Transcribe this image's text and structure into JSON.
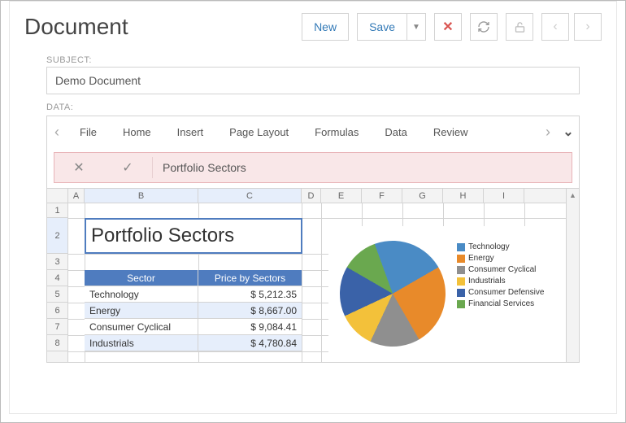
{
  "header": {
    "title": "Document",
    "new_label": "New",
    "save_label": "Save"
  },
  "form": {
    "subject_label": "SUBJECT:",
    "subject_value": "Demo Document",
    "data_label": "DATA:"
  },
  "ribbon": {
    "tabs": [
      "File",
      "Home",
      "Insert",
      "Page Layout",
      "Formulas",
      "Data",
      "Review"
    ]
  },
  "formula_bar": {
    "value": "Portfolio Sectors"
  },
  "grid": {
    "col_letters": [
      "A",
      "B",
      "C",
      "D",
      "E",
      "F",
      "G",
      "H",
      "I"
    ],
    "row_numbers": [
      "1",
      "2",
      "3",
      "4",
      "5",
      "6",
      "7",
      "8"
    ],
    "title_cell": "Portfolio Sectors",
    "headers": {
      "sector": "Sector",
      "price": "Price by Sectors"
    },
    "rows": [
      {
        "sector": "Technology",
        "price": "$ 5,212.35"
      },
      {
        "sector": "Energy",
        "price": "$ 8,667.00"
      },
      {
        "sector": "Consumer Cyclical",
        "price": "$ 9,084.41"
      },
      {
        "sector": "Industrials",
        "price": "$ 4,780.84"
      }
    ]
  },
  "chart_data": {
    "type": "pie",
    "title": "",
    "series": [
      {
        "name": "Technology",
        "value": 5212.35,
        "color": "#4a8bc5"
      },
      {
        "name": "Energy",
        "value": 8667.0,
        "color": "#e88a2a"
      },
      {
        "name": "Consumer Cyclical",
        "value": 9084.41,
        "color": "#8f8f8f"
      },
      {
        "name": "Industrials",
        "value": 4780.84,
        "color": "#f3c13a"
      },
      {
        "name": "Consumer Defensive",
        "value": 4000,
        "color": "#3a62a8"
      },
      {
        "name": "Financial Services",
        "value": 3000,
        "color": "#6aa84f"
      }
    ],
    "legend": [
      "Technology",
      "Energy",
      "Consumer Cyclical",
      "Industrials",
      "Consumer Defensive",
      "Financial Services"
    ]
  }
}
